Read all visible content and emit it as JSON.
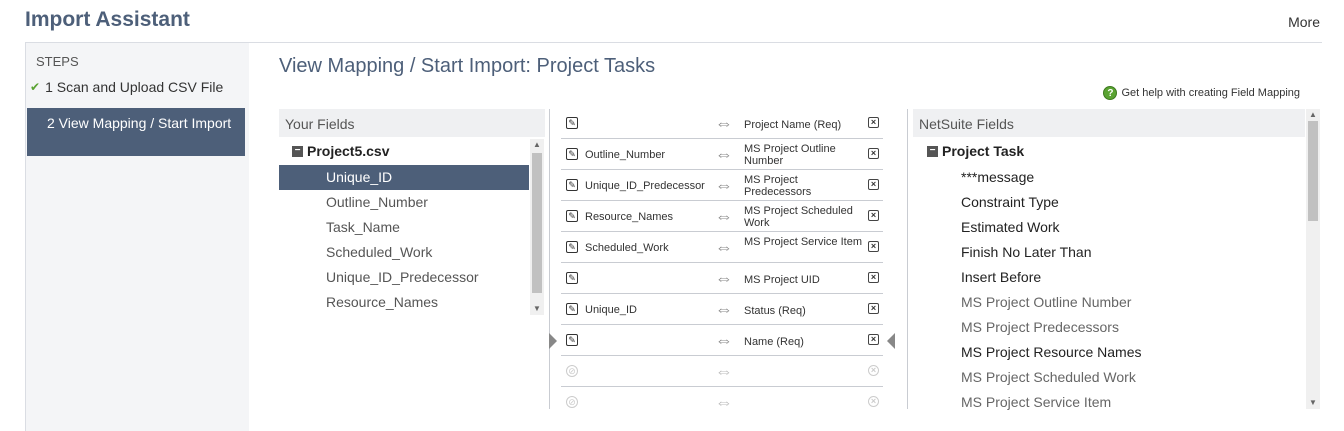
{
  "header": {
    "title": "Import Assistant",
    "more_label": "More"
  },
  "steps": {
    "title": "STEPS",
    "items": [
      {
        "label": "1 Scan and Upload CSV File",
        "done": true
      },
      {
        "label": "2 View Mapping / Start Import",
        "active": true
      }
    ]
  },
  "main": {
    "title": "View Mapping / Start Import: Project Tasks",
    "help_label": "Get help with creating Field Mapping"
  },
  "your_fields": {
    "header": "Your Fields",
    "root": "Project5.csv",
    "items": [
      "Unique_ID",
      "Outline_Number",
      "Task_Name",
      "Scheduled_Work",
      "Unique_ID_Predecessor",
      "Resource_Names"
    ],
    "selected_index": 0
  },
  "mappings": [
    {
      "left": "",
      "right": "Project Name (Req)"
    },
    {
      "left": "Outline_Number",
      "right": "MS Project Outline Number"
    },
    {
      "left": "Unique_ID_Predecessor",
      "right": "MS Project Predecessors"
    },
    {
      "left": "Resource_Names",
      "right": "MS Project Scheduled Work"
    },
    {
      "left": "Scheduled_Work",
      "right": "MS Project Service Item"
    },
    {
      "left": "",
      "right": "MS Project UID"
    },
    {
      "left": "Unique_ID",
      "right": "Status (Req)"
    },
    {
      "left": "",
      "right": "Name (Req)"
    },
    {
      "left": "",
      "right": ""
    },
    {
      "left": "",
      "right": ""
    }
  ],
  "netsuite_fields": {
    "header": "NetSuite Fields",
    "root": "Project Task",
    "items": [
      {
        "label": "***message",
        "mapped": false
      },
      {
        "label": "Constraint Type",
        "mapped": false
      },
      {
        "label": "Estimated Work",
        "mapped": false
      },
      {
        "label": "Finish No Later Than",
        "mapped": false
      },
      {
        "label": "Insert Before",
        "mapped": false
      },
      {
        "label": "MS Project Outline Number",
        "mapped": true
      },
      {
        "label": "MS Project Predecessors",
        "mapped": true
      },
      {
        "label": "MS Project Resource Names",
        "mapped": false
      },
      {
        "label": "MS Project Scheduled Work",
        "mapped": true
      },
      {
        "label": "MS Project Service Item",
        "mapped": true
      }
    ]
  },
  "colors": {
    "accent": "#4d5f79",
    "check": "#5aa332"
  }
}
